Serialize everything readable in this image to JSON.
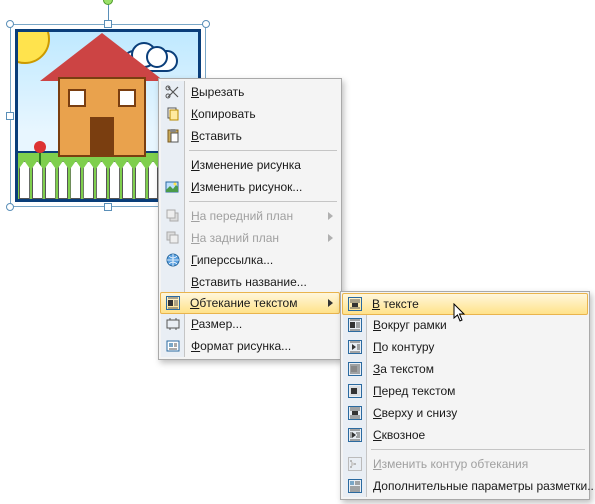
{
  "image": {
    "alt": "house-clipart"
  },
  "menu1": {
    "items": [
      {
        "key": "cut",
        "label": "Вырезать",
        "type": "item",
        "enabled": true
      },
      {
        "key": "copy",
        "label": "Копировать",
        "type": "item",
        "enabled": true
      },
      {
        "key": "paste",
        "label": "Вставить",
        "type": "item",
        "enabled": true
      },
      {
        "key": "sep1",
        "type": "sep"
      },
      {
        "key": "change-pic",
        "label": "Изменение рисунка",
        "type": "item",
        "enabled": true
      },
      {
        "key": "edit-pic",
        "label": "Изменить рисунок...",
        "type": "item",
        "enabled": true
      },
      {
        "key": "sep2",
        "type": "sep"
      },
      {
        "key": "bring-front",
        "label": "На передний план",
        "type": "sub",
        "enabled": false
      },
      {
        "key": "send-back",
        "label": "На задний план",
        "type": "sub",
        "enabled": false
      },
      {
        "key": "hyperlink",
        "label": "Гиперссылка...",
        "type": "item",
        "enabled": true
      },
      {
        "key": "caption",
        "label": "Вставить название...",
        "type": "item",
        "enabled": true
      },
      {
        "key": "wrap-text",
        "label": "Обтекание текстом",
        "type": "sub",
        "enabled": true,
        "highlight": true
      },
      {
        "key": "size",
        "label": "Размер...",
        "type": "item",
        "enabled": true
      },
      {
        "key": "format-pic",
        "label": "Формат рисунка...",
        "type": "item",
        "enabled": true
      }
    ]
  },
  "menu2": {
    "items": [
      {
        "key": "inline",
        "label": "В тексте",
        "enabled": true,
        "highlight": true
      },
      {
        "key": "square",
        "label": "Вокруг рамки",
        "enabled": true
      },
      {
        "key": "tight",
        "label": "По контуру",
        "enabled": true
      },
      {
        "key": "behind",
        "label": "За текстом",
        "enabled": true
      },
      {
        "key": "infront",
        "label": "Перед текстом",
        "enabled": true
      },
      {
        "key": "topbottom",
        "label": "Сверху и снизу",
        "enabled": true
      },
      {
        "key": "through",
        "label": "Сквозное",
        "enabled": true
      },
      {
        "key": "sep",
        "type": "sep"
      },
      {
        "key": "editwrap",
        "label": "Изменить контур обтекания",
        "enabled": false
      },
      {
        "key": "morelayout",
        "label": "Дополнительные параметры разметки...",
        "enabled": true
      }
    ]
  }
}
